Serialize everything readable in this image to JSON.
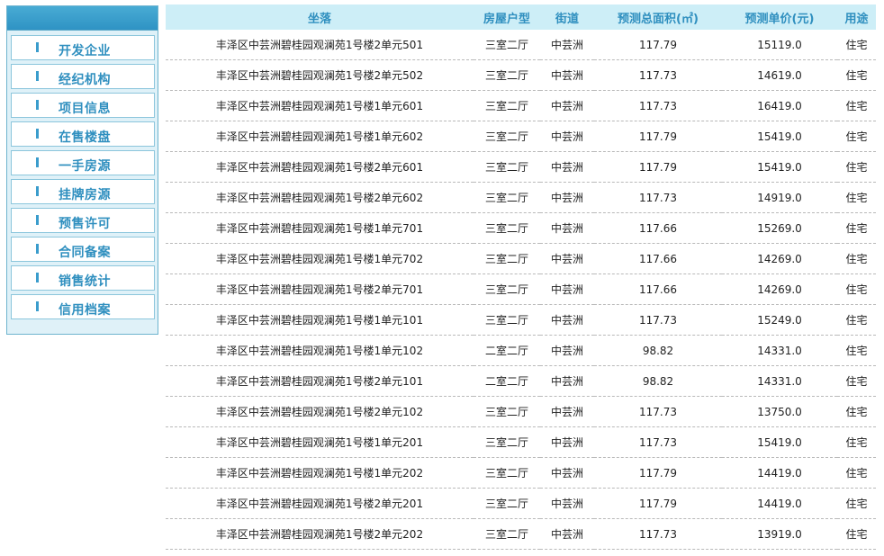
{
  "sidebar": {
    "items": [
      {
        "label": "开发企业"
      },
      {
        "label": "经纪机构"
      },
      {
        "label": "项目信息"
      },
      {
        "label": "在售楼盘"
      },
      {
        "label": "一手房源"
      },
      {
        "label": "挂牌房源"
      },
      {
        "label": "预售许可"
      },
      {
        "label": "合同备案"
      },
      {
        "label": "销售统计"
      },
      {
        "label": "信用档案"
      }
    ]
  },
  "table": {
    "headers": [
      "坐落",
      "房屋户型",
      "街道",
      "预测总面积(㎡)",
      "预测单价(元)",
      "用途"
    ],
    "rows": [
      [
        "丰泽区中芸洲碧桂园观澜苑1号楼2单元501",
        "三室二厅",
        "中芸洲",
        "117.79",
        "15119.0",
        "住宅"
      ],
      [
        "丰泽区中芸洲碧桂园观澜苑1号楼2单元502",
        "三室二厅",
        "中芸洲",
        "117.73",
        "14619.0",
        "住宅"
      ],
      [
        "丰泽区中芸洲碧桂园观澜苑1号楼1单元601",
        "三室二厅",
        "中芸洲",
        "117.73",
        "16419.0",
        "住宅"
      ],
      [
        "丰泽区中芸洲碧桂园观澜苑1号楼1单元602",
        "三室二厅",
        "中芸洲",
        "117.79",
        "15419.0",
        "住宅"
      ],
      [
        "丰泽区中芸洲碧桂园观澜苑1号楼2单元601",
        "三室二厅",
        "中芸洲",
        "117.79",
        "15419.0",
        "住宅"
      ],
      [
        "丰泽区中芸洲碧桂园观澜苑1号楼2单元602",
        "三室二厅",
        "中芸洲",
        "117.73",
        "14919.0",
        "住宅"
      ],
      [
        "丰泽区中芸洲碧桂园观澜苑1号楼1单元701",
        "三室二厅",
        "中芸洲",
        "117.66",
        "15269.0",
        "住宅"
      ],
      [
        "丰泽区中芸洲碧桂园观澜苑1号楼1单元702",
        "三室二厅",
        "中芸洲",
        "117.66",
        "14269.0",
        "住宅"
      ],
      [
        "丰泽区中芸洲碧桂园观澜苑1号楼2单元701",
        "三室二厅",
        "中芸洲",
        "117.66",
        "14269.0",
        "住宅"
      ],
      [
        "丰泽区中芸洲碧桂园观澜苑1号楼1单元101",
        "三室二厅",
        "中芸洲",
        "117.73",
        "15249.0",
        "住宅"
      ],
      [
        "丰泽区中芸洲碧桂园观澜苑1号楼1单元102",
        "二室二厅",
        "中芸洲",
        "98.82",
        "14331.0",
        "住宅"
      ],
      [
        "丰泽区中芸洲碧桂园观澜苑1号楼2单元101",
        "二室二厅",
        "中芸洲",
        "98.82",
        "14331.0",
        "住宅"
      ],
      [
        "丰泽区中芸洲碧桂园观澜苑1号楼2单元102",
        "三室二厅",
        "中芸洲",
        "117.73",
        "13750.0",
        "住宅"
      ],
      [
        "丰泽区中芸洲碧桂园观澜苑1号楼1单元201",
        "三室二厅",
        "中芸洲",
        "117.73",
        "15419.0",
        "住宅"
      ],
      [
        "丰泽区中芸洲碧桂园观澜苑1号楼1单元202",
        "三室二厅",
        "中芸洲",
        "117.79",
        "14419.0",
        "住宅"
      ],
      [
        "丰泽区中芸洲碧桂园观澜苑1号楼2单元201",
        "三室二厅",
        "中芸洲",
        "117.79",
        "14419.0",
        "住宅"
      ],
      [
        "丰泽区中芸洲碧桂园观澜苑1号楼2单元202",
        "三室二厅",
        "中芸洲",
        "117.73",
        "13919.0",
        "住宅"
      ]
    ]
  },
  "colors": {
    "accent": "#2f8fbf",
    "header_bg": "#cdeef7",
    "sidebar_bg": "#dff1f8"
  }
}
